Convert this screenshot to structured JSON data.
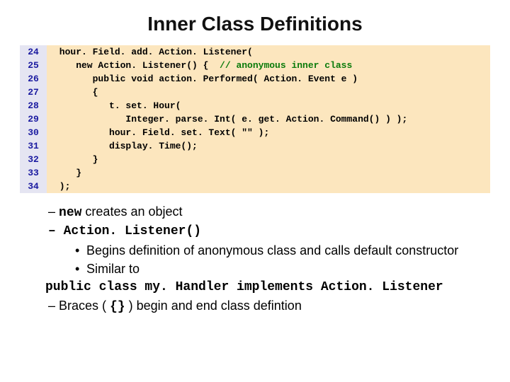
{
  "title": "Inner Class Definitions",
  "code": {
    "lines": [
      {
        "n": "24",
        "txt": " hour. Field. add. Action. Listener("
      },
      {
        "n": "25",
        "txt": "    new Action. Listener() {",
        "cmt": "  // anonymous inner class"
      },
      {
        "n": "26",
        "txt": "       public void action. Performed( Action. Event e )"
      },
      {
        "n": "27",
        "txt": "       {"
      },
      {
        "n": "28",
        "txt": "          t. set. Hour("
      },
      {
        "n": "29",
        "txt": "             Integer. parse. Int( e. get. Action. Command() ) );"
      },
      {
        "n": "30",
        "txt": "          hour. Field. set. Text( \"\" );"
      },
      {
        "n": "31",
        "txt": "          display. Time();"
      },
      {
        "n": "32",
        "txt": "       }"
      },
      {
        "n": "33",
        "txt": "    }"
      },
      {
        "n": "34",
        "txt": " );"
      }
    ]
  },
  "bullets": {
    "l1_pre": "new",
    "l1_post": " creates an object",
    "l2": "Action. Listener()",
    "l3": "Begins definition of anonymous class and calls default constructor",
    "l4": "Similar to",
    "l5": "public class my. Handler implements Action. Listener",
    "l6_pre": "Braces ( ",
    "l6_mid": "{}",
    "l6_post": " ) begin and end class defintion"
  }
}
